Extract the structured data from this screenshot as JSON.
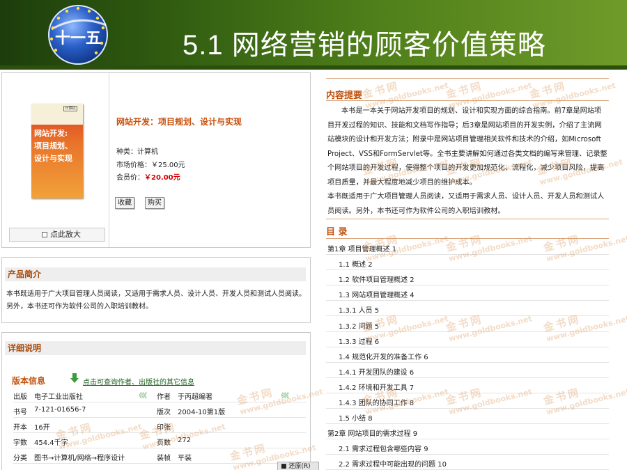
{
  "header": {
    "title": "5.1 网络营销的顾客价值策略",
    "logo_text": "十一五"
  },
  "product": {
    "cover": {
      "tag": "计算机",
      "line1": "网站开发:",
      "line2": "项目规划、",
      "line3": "设计与实现"
    },
    "title": "网站开发：项目规划、设计与实现",
    "category": "种类：计算机",
    "market_price": "市场价格：￥25.00元",
    "member_price_label": "会员价：",
    "member_price_value": "￥20.00元",
    "collect_button": "收藏",
    "buy_button": "购买",
    "zoom_label": "点此放大"
  },
  "summary": {
    "heading": "产品简介",
    "text": "本书既适用于广大项目管理人员阅读，又适用于需求人员、设计人员、开发人员和测试人员阅读。另外，本书还可作为软件公司的入职培训教材。"
  },
  "detail": {
    "heading": "详细说明",
    "pub_heading": "版本信息",
    "pub_link": "点击可查询作者、出版社的其它信息",
    "rows": [
      {
        "k1": "出版",
        "v1": "电子工业出版社",
        "k2": "作者",
        "v2": "于丙超编著"
      },
      {
        "k1": "书号",
        "v1": "7-121-01656-7",
        "k2": "版次",
        "v2": "2004-10第1版"
      },
      {
        "k1": "开本",
        "v1": "16开",
        "k2": "印张",
        "v2": ""
      },
      {
        "k1": "字数",
        "v1": "454.4千字",
        "k2": "页数",
        "v2": "272"
      },
      {
        "k1": "分类",
        "v1": "图书→计算机/网络→程序设计",
        "k2": "装帧",
        "v2": "平装"
      }
    ]
  },
  "statusbar": {
    "text": "■ 还原(R)"
  },
  "content": {
    "intro_heading": "内容提要",
    "intro_p1": "本书是一本关于网站开发项目的规划、设计和实现方面的综合指南。前7章是网站项目开发过程的知识、技能和文档写作指导；后3章是网站项目的开发实例，介绍了主流网站模块的设计和开发方法；附录中是网站项目管理相关软件和技术的介绍，如Microsoft Project、VSS和FormServlet等。全书主要讲解如何通过各类文档的编写来管理、记录整个网站项目的开发过程，使得整个项目的开发更加规范化、流程化，减少项目风险，提高项目质量，并最大程度地减少项目的维护成本。",
    "intro_p2": "本书既适用于广大项目管理人员阅读，又适用于需求人员、设计人员、开发人员和测试人员阅读。另外，本书还可作为软件公司的入职培训教材。",
    "toc_heading": "目 录",
    "toc": [
      "第1章  项目管理概述 1",
      "1.1  概述 2",
      "1.2  软件项目管理概述 2",
      "1.3  网站项目管理概述 4",
      "1.3.1  人员 5",
      "1.3.2  问题 5",
      "1.3.3  过程 6",
      "1.4  规范化开发的准备工作 6",
      "1.4.1  开发团队的建设 6",
      "1.4.2  环境和开发工具 7",
      "1.4.3  团队的协同工作 8",
      "1.5  小结 8",
      "第2章  网站项目的需求过程 9",
      "2.1  需求过程包含哪些内容 9",
      "2.2  需求过程中可能出现的问题 10"
    ]
  },
  "watermark": {
    "cn": "金书网",
    "url": "www.goldbooks.net"
  },
  "colors": {
    "header_green": "#2f5a10",
    "heading_orange": "#c0500b",
    "price_red": "#d40000",
    "link_green": "#1b5e1b"
  }
}
